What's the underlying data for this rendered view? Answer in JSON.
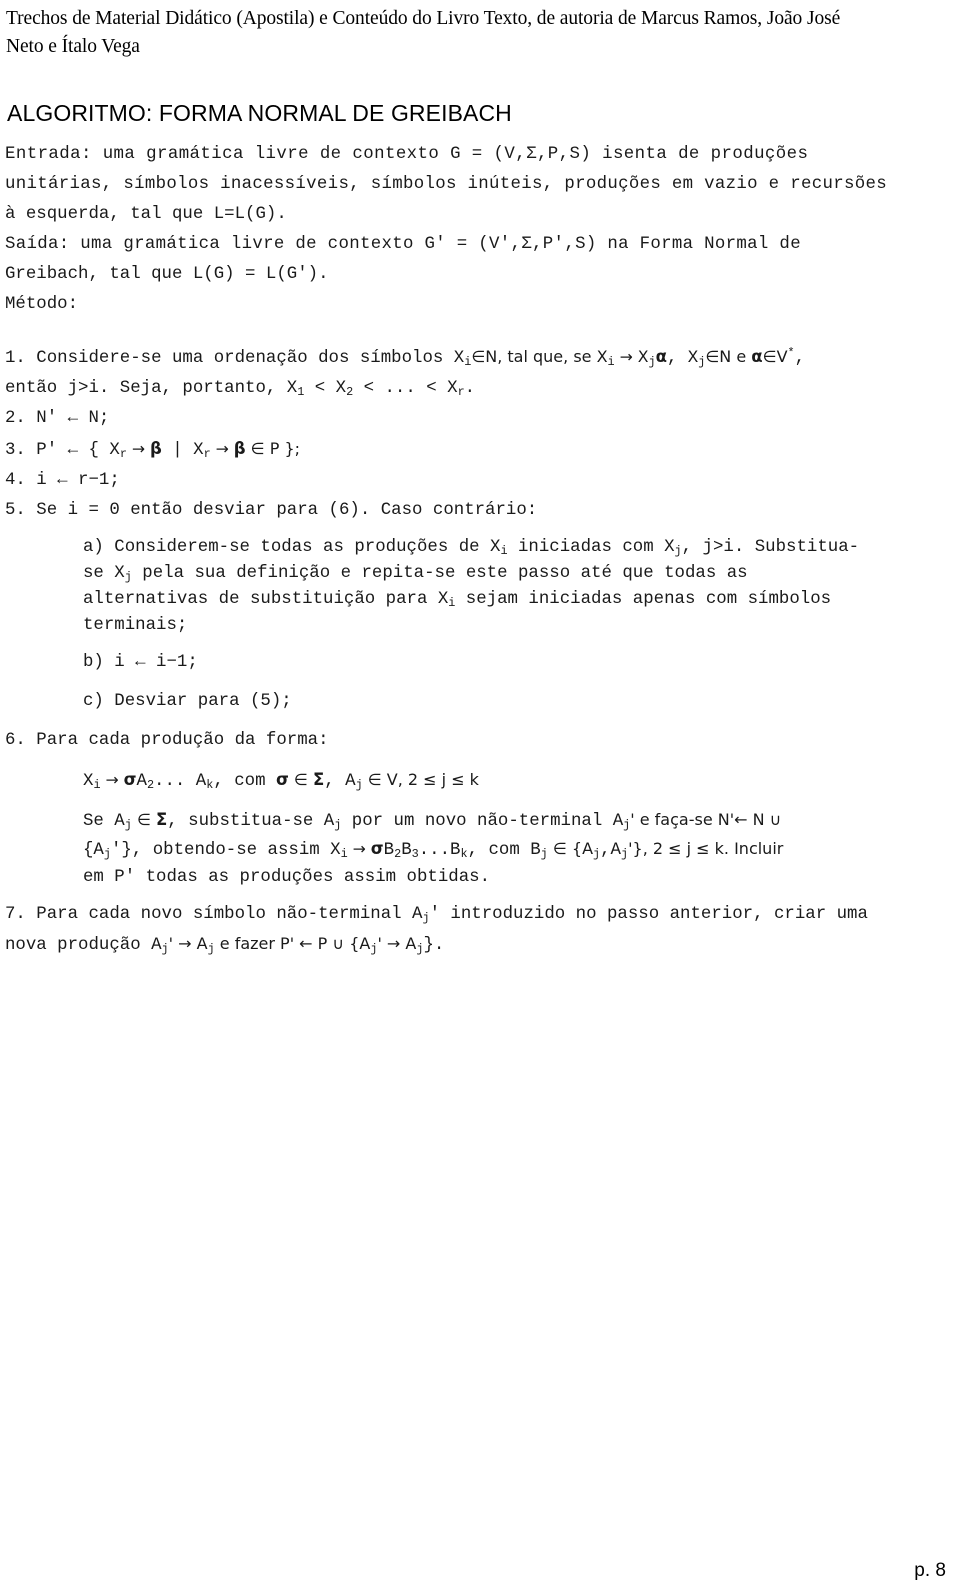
{
  "header": {
    "line1": "Trechos de Material Didático (Apostila) e Conteúdo do Livro Texto, de autoria de Marcus Ramos, João José",
    "line2": "Neto e Ítalo Vega"
  },
  "title": "ALGORITMO: FORMA NORMAL DE GREIBACH",
  "entrada": {
    "line1": "Entrada: uma gramática livre de contexto G = (V,Σ,P,S) isenta de produções",
    "line2": "unitárias, símbolos inacessíveis, símbolos inúteis, produções em vazio e recursões",
    "line3": "à esquerda, tal que L=L(G)."
  },
  "saida": {
    "line1": "Saída: uma gramática livre de contexto G' = (V',Σ,P',S) na Forma Normal de",
    "line2": "Greibach, tal que L(G) = L(G')."
  },
  "metodo_label": "Método:",
  "steps": {
    "s1_a_pre": "1. Considere-se uma ordenação dos símbolos X",
    "s1_a_sub1": "i",
    "s1_a_mid1": "∈N, tal que, se X",
    "s1_a_sub2": "i",
    "s1_a_arrow": " → X",
    "s1_a_sub3": "j",
    "s1_a_alpha": "α",
    "s1_a_mid2": ", X",
    "s1_a_sub4": "j",
    "s1_a_mid3": "∈N e ",
    "s1_a_alpha2": "α",
    "s1_a_mid4": "∈V",
    "s1_a_sup": "*",
    "s1_a_end": ",",
    "s1_b_pre": "então j>i. Seja, portanto, X",
    "s1_b_sub1": "1",
    "s1_b_mid1": " < X",
    "s1_b_sub2": "2",
    "s1_b_mid2": " < ... < X",
    "s1_b_sub3": "r",
    "s1_b_end": ".",
    "s2": "2. N' ← N;",
    "s3_pre": "3. P' ← { X",
    "s3_sub1": "r",
    "s3_mid1": " → ",
    "s3_beta1": "β",
    "s3_mid2": " | X",
    "s3_sub2": "r",
    "s3_mid3": " → ",
    "s3_beta2": "β",
    "s3_mid4": " ∈ P };",
    "s4": "4. i ← r−1;",
    "s5": "5. Se i = 0 então desviar para (6). Caso contrário:",
    "a_l1_pre": "a) Considerem-se todas as produções de X",
    "a_l1_sub1": "i",
    "a_l1_mid1": " iniciadas com X",
    "a_l1_sub2": "j",
    "a_l1_end": ", j>i. Substitua-",
    "a_l2_pre": "se X",
    "a_l2_sub1": "j",
    "a_l2_end": " pela sua definição e repita-se este passo até que todas as",
    "a_l3_pre": "alternativas de substituição para X",
    "a_l3_sub1": "i",
    "a_l3_end": " sejam iniciadas apenas com símbolos",
    "a_l4": "terminais;",
    "b": "b) i ← i−1;",
    "c": "c) Desviar para (5);",
    "s6": "6. Para cada produção da forma:",
    "s6_f_pre": "X",
    "s6_f_sub1": "i",
    "s6_f_arrow": " → ",
    "s6_f_sigma": "σ",
    "s6_f_a": "A",
    "s6_f_sub2": "2",
    "s6_f_dots": "... A",
    "s6_f_sub3": "k",
    "s6_f_mid": ", com ",
    "s6_f_sigma2": "σ",
    "s6_f_in1": " ∈ ",
    "s6_f_sum": "Σ",
    "s6_f_mid2": ", A",
    "s6_f_sub4": "j",
    "s6_f_in2": " ∈ V, 2 ≤ j ≤ k",
    "s6_p1_pre": "Se A",
    "s6_p1_sub1": "j",
    "s6_p1_in": " ∈ ",
    "s6_p1_sum": "Σ",
    "s6_p1_mid1": ", substitua-se A",
    "s6_p1_sub2": "j",
    "s6_p1_mid2": " por um novo não-terminal A",
    "s6_p1_sub3": "j",
    "s6_p1_end": "' e faça-se N'← N ∪",
    "s6_p2_pre": "{A",
    "s6_p2_sub1": "j",
    "s6_p2_mid1": "'}, obtendo-se assim X",
    "s6_p2_sub2": "i",
    "s6_p2_arrow": " → ",
    "s6_p2_sigma": "σ",
    "s6_p2_b": "B",
    "s6_p2_sub3": "2",
    "s6_p2_b2": "B",
    "s6_p2_sub4": "3",
    "s6_p2_dots": "...B",
    "s6_p2_sub5": "k",
    "s6_p2_mid2": ", com B",
    "s6_p2_sub6": "j",
    "s6_p2_mid3": " ∈ {A",
    "s6_p2_sub7": "j",
    "s6_p2_mid4": ",A",
    "s6_p2_sub8": "j",
    "s6_p2_end": "'}, 2 ≤ j ≤ k. Incluir",
    "s6_p3": "em P' todas as produções assim obtidas.",
    "s7_l1_pre": "7. Para cada novo símbolo não-terminal A",
    "s7_l1_sub1": "j",
    "s7_l1_end": "' introduzido no passo anterior, criar uma",
    "s7_l2_pre": "nova produção A",
    "s7_l2_sub1": "j",
    "s7_l2_mid1": "' → A",
    "s7_l2_sub2": "j",
    "s7_l2_mid2": " e fazer P' ← P ∪ {A",
    "s7_l2_sub3": "j",
    "s7_l2_mid3": "' → A",
    "s7_l2_sub4": "j",
    "s7_l2_end": "}."
  },
  "footer": "p. 8"
}
